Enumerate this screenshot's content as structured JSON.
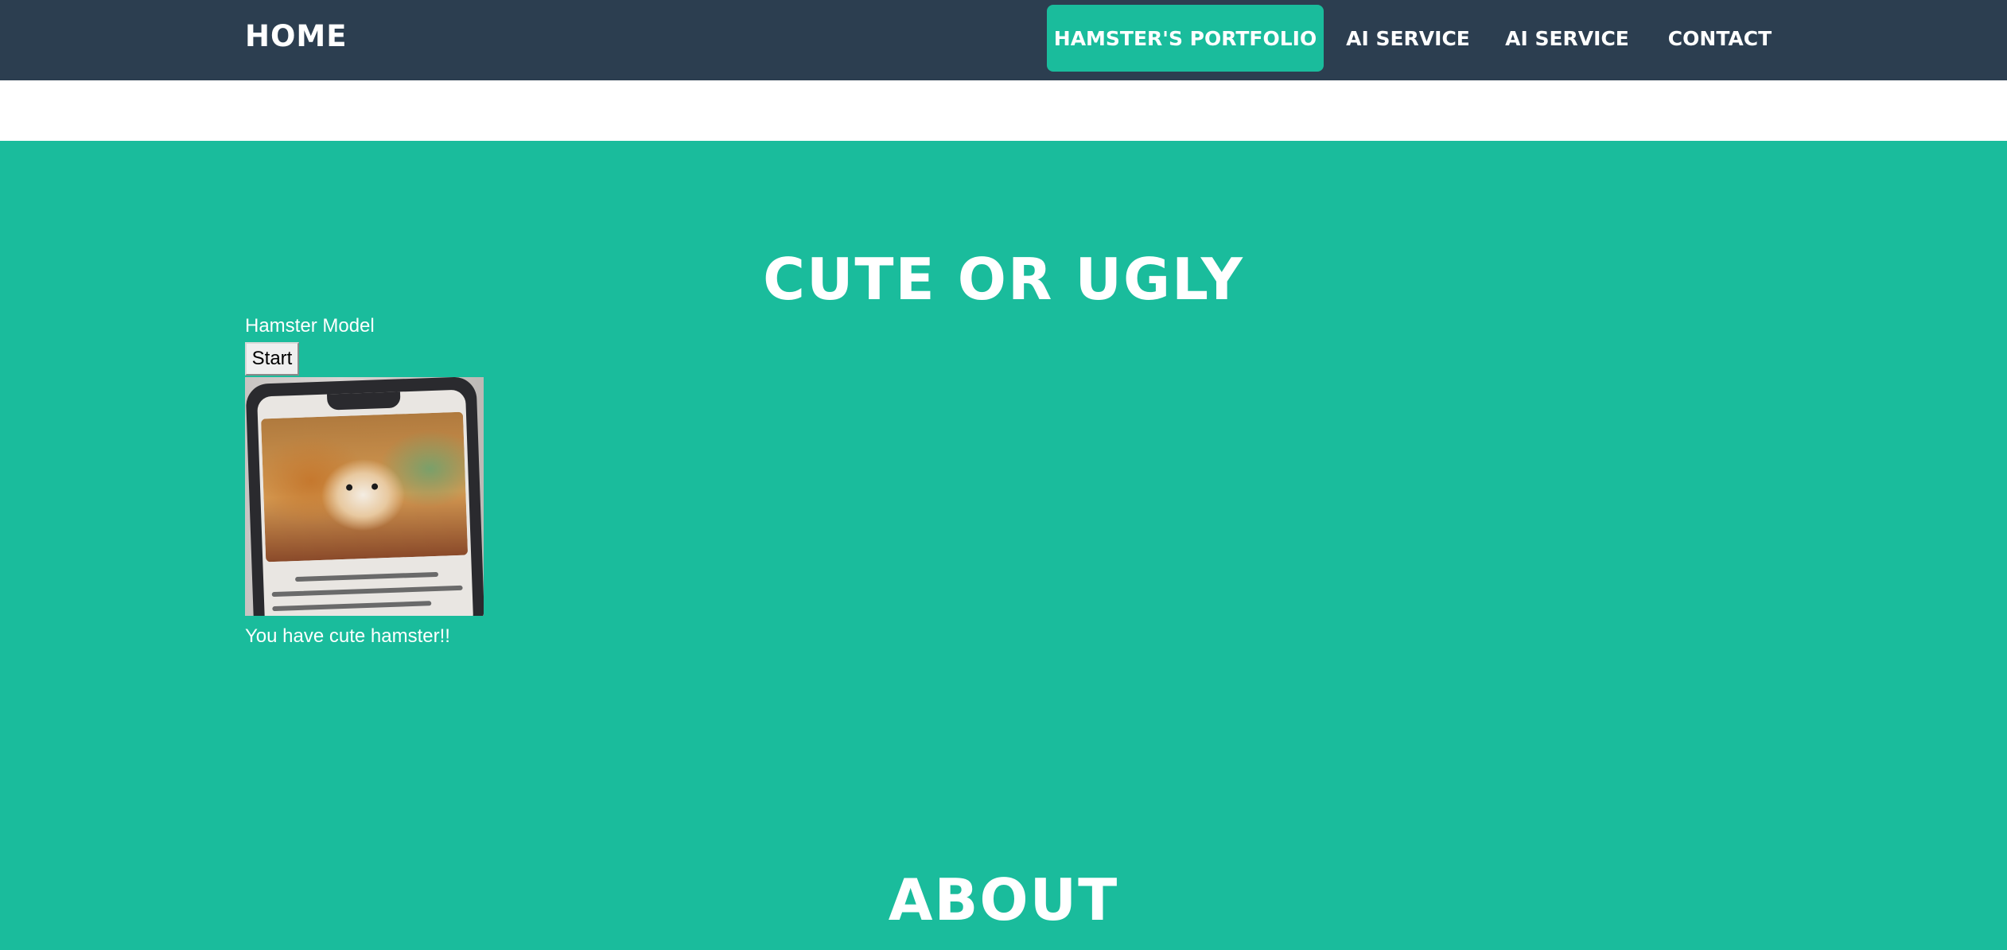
{
  "navbar": {
    "brand": "HOME",
    "items": [
      {
        "label": "HAMSTER'S PORTFOLIO",
        "active": true
      },
      {
        "label": "AI SERVICE",
        "active": false
      },
      {
        "label": "AI SERVICE",
        "active": false
      },
      {
        "label": "CONTACT",
        "active": false
      }
    ]
  },
  "main": {
    "title": "CUTE OR UGLY",
    "model_label": "Hamster Model",
    "start_label": "Start",
    "result": "You have cute hamster!!",
    "next_section_title": "ABOUT"
  },
  "colors": {
    "navbar_bg": "#2c3e50",
    "accent": "#1abc9c",
    "text_light": "#ffffff"
  },
  "icons": {
    "webcam": "webcam-preview-image"
  }
}
